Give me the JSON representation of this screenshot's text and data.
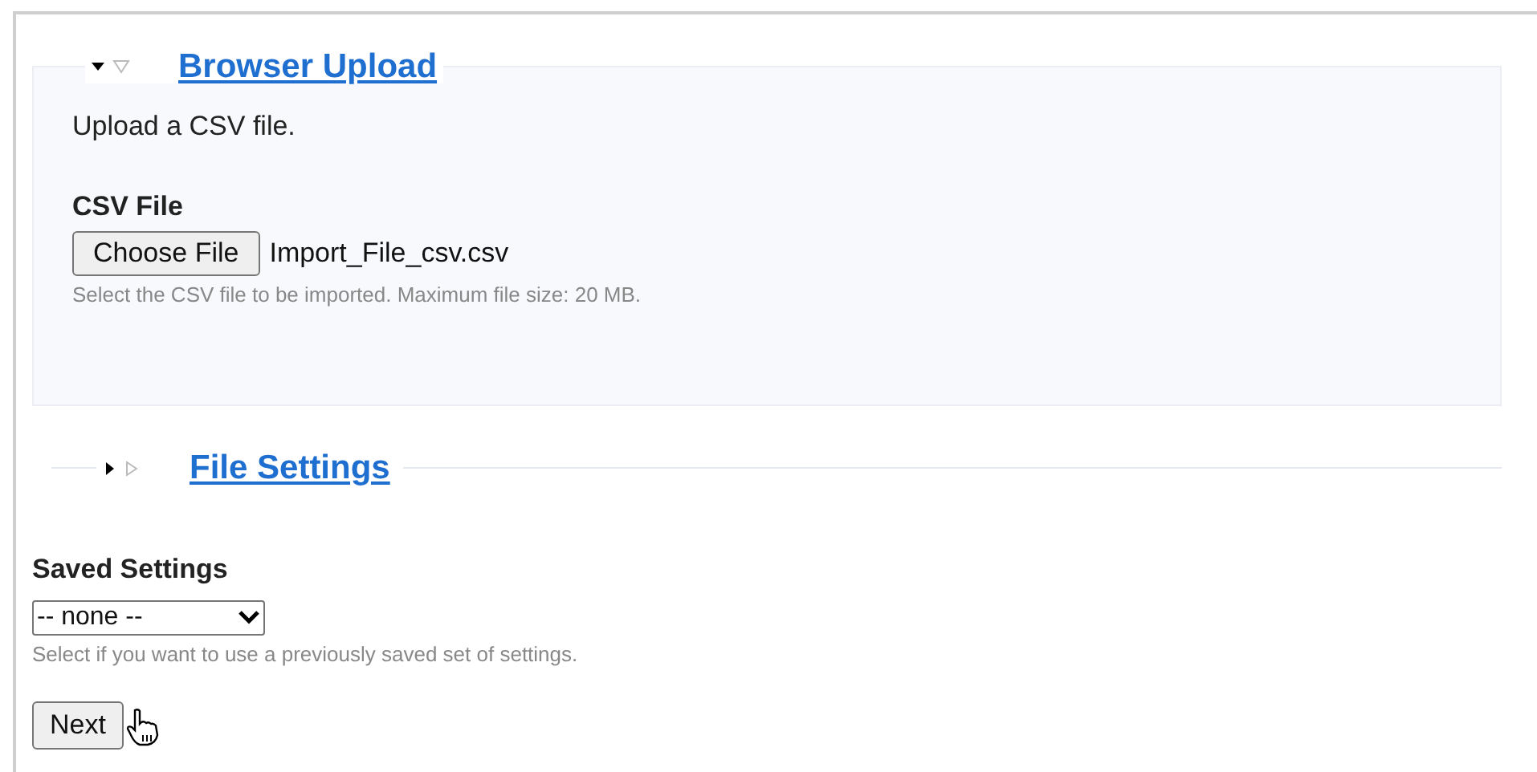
{
  "sections": [
    {
      "title": "Browser Upload",
      "expanded": true,
      "intro": "Upload a CSV file.",
      "field": {
        "label": "CSV File",
        "button": "Choose File",
        "filename": "Import_File_csv.csv",
        "help": "Select the CSV file to be imported. Maximum file size: 20 MB."
      }
    },
    {
      "title": "File Settings",
      "expanded": false
    }
  ],
  "saved_settings": {
    "label": "Saved Settings",
    "value": "-- none --",
    "help": "Select if you want to use a previously saved set of settings."
  },
  "next_button": "Next"
}
